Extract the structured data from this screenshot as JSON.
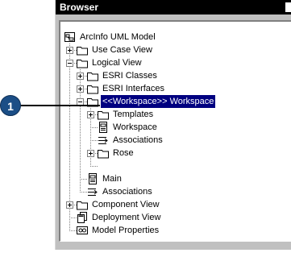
{
  "window": {
    "title": "Browser"
  },
  "callout": {
    "number": "1"
  },
  "tree": {
    "root": "ArcInfo UML Model",
    "use_case_view": "Use Case View",
    "logical_view": "Logical View",
    "esri_classes": "ESRI Classes",
    "esri_interfaces": "ESRI Interfaces",
    "workspace_pkg": "<<Workspace>> Workspace",
    "templates": "Templates",
    "workspace": "Workspace",
    "associations_inner": "Associations",
    "rose": "Rose",
    "main": "Main",
    "associations": "Associations",
    "component_view": "Component View",
    "deployment_view": "Deployment View",
    "model_properties": "Model Properties"
  },
  "icons": {
    "folder": "folder-icon",
    "model": "model-icon",
    "diagram": "class-diagram-icon",
    "associations": "associations-icon",
    "deployment": "deployment-icon",
    "properties": "model-properties-icon"
  }
}
